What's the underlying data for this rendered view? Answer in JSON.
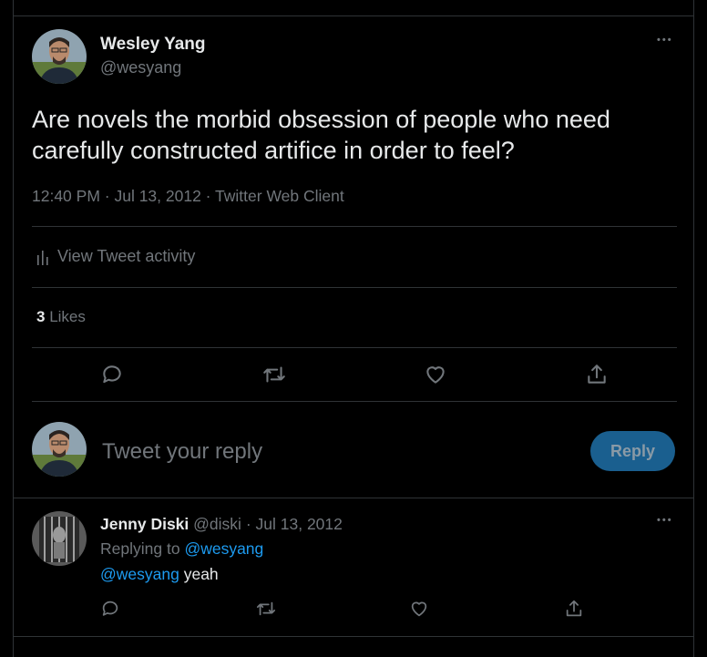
{
  "main_tweet": {
    "author_name": "Wesley Yang",
    "author_handle": "@wesyang",
    "more_label": "•••",
    "text": "Are novels the morbid obsession of people who need carefully constructed artifice in order to feel?",
    "meta": "12:40 PM · Jul 13, 2012 · Twitter Web Client",
    "activity_label": "View Tweet activity",
    "likes_count": "3",
    "likes_label": "Likes",
    "actions": [
      "reply-icon",
      "retweet-icon",
      "like-icon",
      "share-icon"
    ]
  },
  "compose": {
    "placeholder": "Tweet your reply",
    "button_label": "Reply",
    "button_color": "#1d9bf0"
  },
  "reply_tweet": {
    "author_name": "Jenny Diski",
    "author_handle": "@diski",
    "separator": "·",
    "date": "Jul 13, 2012",
    "more_label": "•••",
    "replying_prefix": "Replying to",
    "replying_to": "@wesyang",
    "mention": "@wesyang",
    "text": "yeah"
  },
  "colors": {
    "background": "#000000",
    "text": "#e7e9ea",
    "muted": "#71767b",
    "accent": "#1d9bf0",
    "border": "#2f3336"
  }
}
